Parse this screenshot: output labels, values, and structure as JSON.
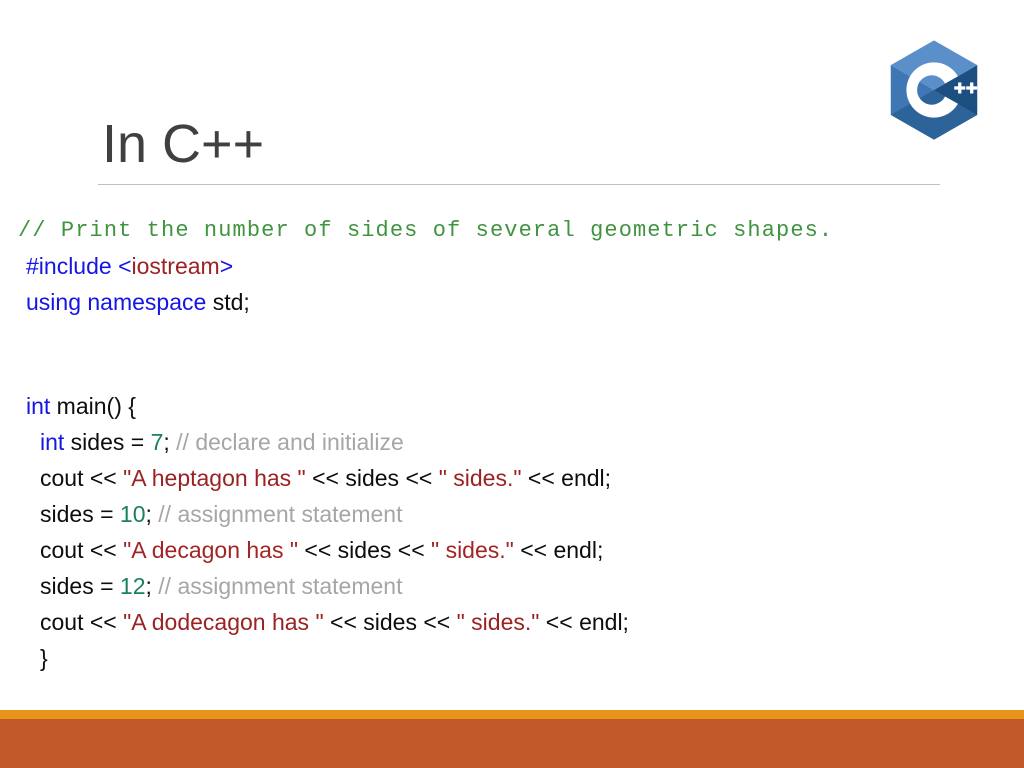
{
  "slide": {
    "title": "In C++",
    "logo_name": "cpp-logo",
    "accent_orange": "#e8941a",
    "accent_brown": "#c0582a",
    "title_color": "#404040",
    "rule_color": "#bfbfbf"
  },
  "logo": {
    "letter": "C",
    "plus_left": "+",
    "plus_right": "+",
    "hex_light": "#5b8fc9",
    "hex_mid": "#3a6ea8",
    "hex_dark": "#1c4e80",
    "letter_color": "#ffffff"
  },
  "code": {
    "lines": [
      {
        "id": "line-comment-intro",
        "mono": true,
        "indent": 0,
        "tokens": [
          {
            "t": "// Print the number of sides of several geometric shapes.",
            "c": "tok-comment-green"
          }
        ]
      },
      {
        "id": "line-include",
        "mono": false,
        "indent": 1,
        "tokens": [
          {
            "t": "#include ",
            "c": "tok-keyword"
          },
          {
            "t": "<",
            "c": "tok-angle"
          },
          {
            "t": "iostream",
            "c": "tok-header"
          },
          {
            "t": ">",
            "c": "tok-angle"
          }
        ]
      },
      {
        "id": "line-using",
        "mono": false,
        "indent": 1,
        "tokens": [
          {
            "t": "using namespace ",
            "c": "tok-keyword"
          },
          {
            "t": "std;",
            "c": "tok-plain"
          }
        ]
      },
      {
        "id": "line-blank-1",
        "mono": false,
        "indent": 0,
        "tokens": []
      },
      {
        "id": "line-blank-2",
        "mono": false,
        "indent": 0,
        "tokens": []
      },
      {
        "id": "line-main",
        "mono": false,
        "indent": 1,
        "tokens": [
          {
            "t": "int",
            "c": "tok-keyword"
          },
          {
            "t": " main() {",
            "c": "tok-plain"
          }
        ]
      },
      {
        "id": "line-declare-sides",
        "mono": false,
        "indent": 2,
        "tokens": [
          {
            "t": "int",
            "c": "tok-keyword"
          },
          {
            "t": " sides = ",
            "c": "tok-plain"
          },
          {
            "t": "7",
            "c": "tok-number"
          },
          {
            "t": "; ",
            "c": "tok-plain"
          },
          {
            "t": "// declare and initialize",
            "c": "tok-comment-gray"
          }
        ]
      },
      {
        "id": "line-cout-heptagon",
        "mono": false,
        "indent": 2,
        "tokens": [
          {
            "t": "cout << ",
            "c": "tok-plain"
          },
          {
            "t": "\"A heptagon has \"",
            "c": "tok-string"
          },
          {
            "t": " << sides << ",
            "c": "tok-plain"
          },
          {
            "t": "\" sides.\"",
            "c": "tok-string"
          },
          {
            "t": " << endl;",
            "c": "tok-plain"
          }
        ]
      },
      {
        "id": "line-assign-10",
        "mono": false,
        "indent": 2,
        "tokens": [
          {
            "t": "sides = ",
            "c": "tok-plain"
          },
          {
            "t": "10",
            "c": "tok-number"
          },
          {
            "t": "; ",
            "c": "tok-plain"
          },
          {
            "t": "// assignment statement",
            "c": "tok-comment-gray"
          }
        ]
      },
      {
        "id": "line-cout-decagon",
        "mono": false,
        "indent": 2,
        "tokens": [
          {
            "t": "cout << ",
            "c": "tok-plain"
          },
          {
            "t": "\"A decagon has \"",
            "c": "tok-string-alt"
          },
          {
            "t": " << sides << ",
            "c": "tok-plain"
          },
          {
            "t": "\" sides.\"",
            "c": "tok-string-alt"
          },
          {
            "t": " << endl;",
            "c": "tok-plain"
          }
        ]
      },
      {
        "id": "line-assign-12",
        "mono": false,
        "indent": 2,
        "tokens": [
          {
            "t": "sides = ",
            "c": "tok-plain"
          },
          {
            "t": "12",
            "c": "tok-number"
          },
          {
            "t": "; ",
            "c": "tok-plain"
          },
          {
            "t": "// assignment statement",
            "c": "tok-comment-gray"
          }
        ]
      },
      {
        "id": "line-cout-dodecagon",
        "mono": false,
        "indent": 2,
        "tokens": [
          {
            "t": "cout << ",
            "c": "tok-plain"
          },
          {
            "t": "\"A dodecagon has \"",
            "c": "tok-string"
          },
          {
            "t": " << sides << ",
            "c": "tok-plain"
          },
          {
            "t": "\" sides.\"",
            "c": "tok-string"
          },
          {
            "t": " << endl;",
            "c": "tok-plain"
          }
        ]
      },
      {
        "id": "line-close-brace",
        "mono": false,
        "indent": 2,
        "tokens": [
          {
            "t": "}",
            "c": "tok-plain"
          }
        ]
      }
    ]
  }
}
